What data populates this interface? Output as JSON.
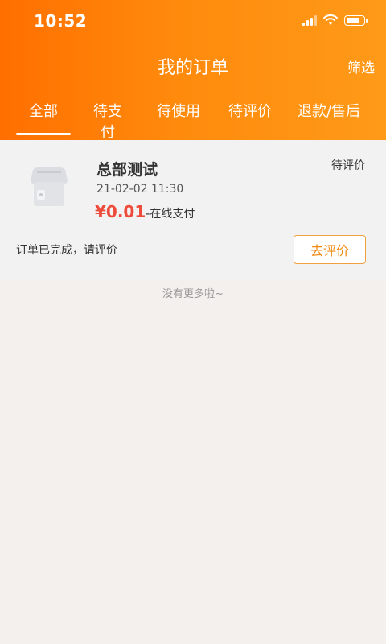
{
  "status_bar": {
    "time": "10:52"
  },
  "header": {
    "title": "我的订单",
    "filter_label": "筛选",
    "tabs": [
      {
        "label": "全部",
        "active": true
      },
      {
        "label": "待支付"
      },
      {
        "label": "待使用"
      },
      {
        "label": "待评价"
      },
      {
        "label": "退款/售后"
      }
    ]
  },
  "order": {
    "shop_name": "总部测试",
    "status": "待评价",
    "datetime": "21-02-02 11:30",
    "price": "¥0.01",
    "pay_method": "-在线支付",
    "note": "订单已完成，请评价",
    "review_button": "去评价"
  },
  "footer_note": "没有更多啦~",
  "colors": {
    "accent": "#ff8a0c",
    "price": "#ee4b3b",
    "button_border": "#f0a040",
    "button_text": "#f08a10"
  }
}
